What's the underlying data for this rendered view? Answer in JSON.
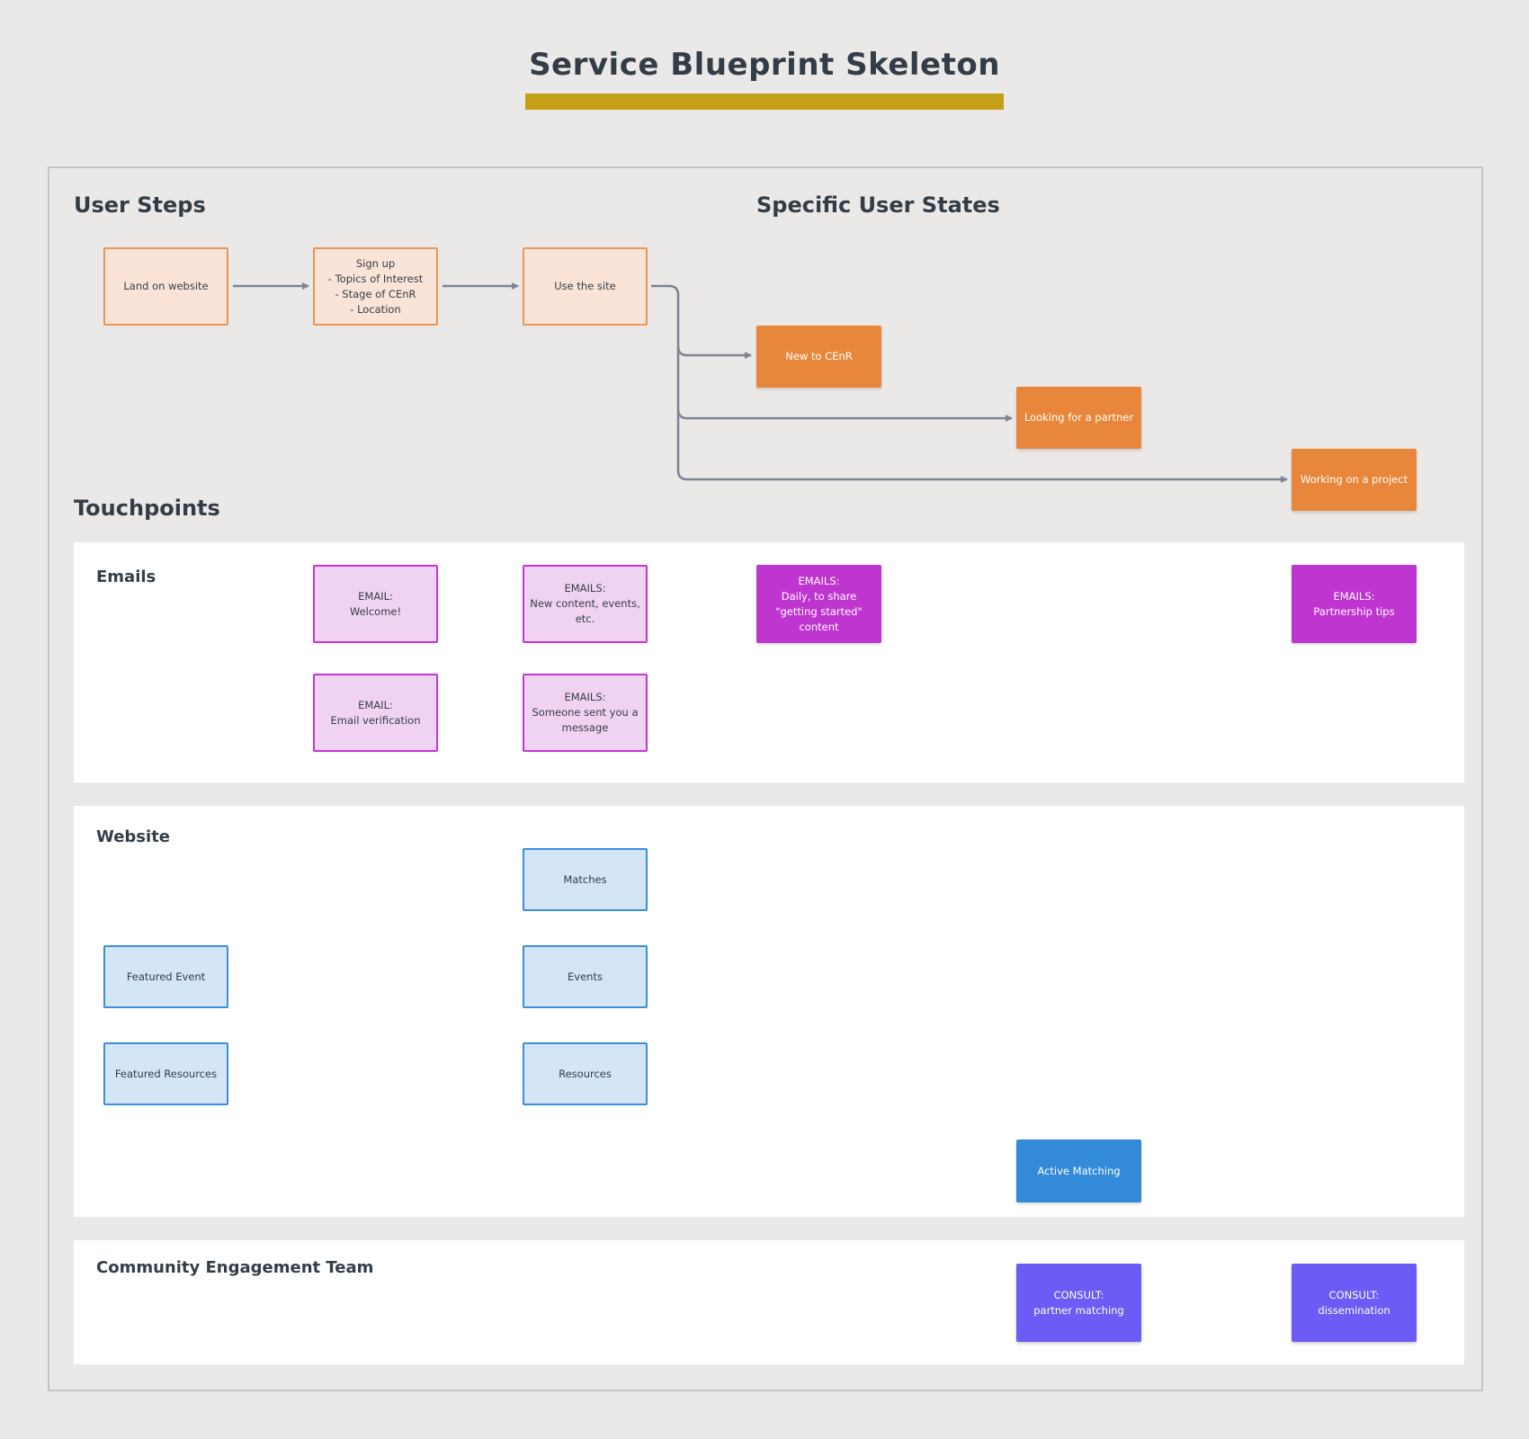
{
  "title": "Service Blueprint Skeleton",
  "colors": {
    "background": "#ebe9e8",
    "title_bar": "#c4a018",
    "heading_text": "#333d47",
    "step_fill": "#fae4d7",
    "step_border": "#ec9556",
    "state_fill": "#e8873b",
    "email_light_fill": "#f0d3f3",
    "email_border": "#c535d8",
    "email_dark_fill": "#bf35cf",
    "web_light_fill": "#d4e5f6",
    "web_border": "#3c8ee0",
    "web_dark_fill": "#328ad9",
    "consult_fill": "#6a5cf5",
    "connector": "#7c8593"
  },
  "sections": {
    "user_steps": "User Steps",
    "specific_user_states": "Specific User States",
    "touchpoints": "Touchpoints"
  },
  "user_steps": [
    {
      "label": "Land on website"
    },
    {
      "label": "Sign up\n- Topics of Interest\n- Stage of CEnR\n- Location"
    },
    {
      "label": "Use the site"
    }
  ],
  "user_states": [
    {
      "label": "New to CEnR"
    },
    {
      "label": "Looking for a partner"
    },
    {
      "label": "Working on a project"
    }
  ],
  "lanes": {
    "emails": {
      "label": "Emails",
      "items": [
        {
          "label": "EMAIL:\nWelcome!"
        },
        {
          "label": "EMAIL:\nEmail verification"
        },
        {
          "label": "EMAILS:\nNew content, events,\netc."
        },
        {
          "label": "EMAILS:\nSomeone sent you a\nmessage"
        },
        {
          "label": "EMAILS:\nDaily, to share\n\"getting started\"\ncontent"
        },
        {
          "label": "EMAILS:\nPartnership tips"
        }
      ]
    },
    "website": {
      "label": "Website",
      "items": [
        {
          "label": "Matches"
        },
        {
          "label": "Featured Event"
        },
        {
          "label": "Events"
        },
        {
          "label": "Featured Resources"
        },
        {
          "label": "Resources"
        },
        {
          "label": "Active Matching"
        }
      ]
    },
    "community_engagement_team": {
      "label": "Community Engagement Team",
      "items": [
        {
          "label": "CONSULT:\npartner matching"
        },
        {
          "label": "CONSULT:\ndissemination"
        }
      ]
    }
  }
}
